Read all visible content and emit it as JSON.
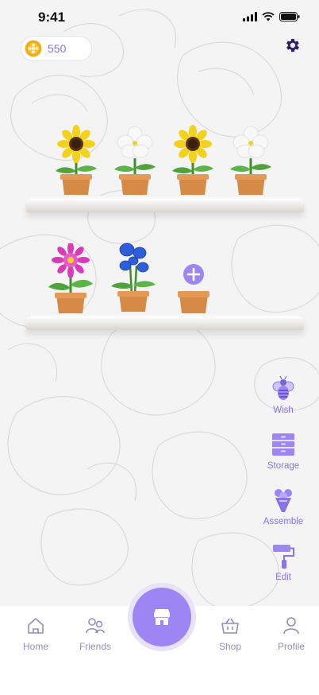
{
  "status_bar": {
    "time": "9:41"
  },
  "coins": {
    "value": "550"
  },
  "shelves": {
    "top": [
      "sunflower",
      "white-flower",
      "sunflower",
      "white-flower"
    ],
    "bottom": [
      "pink-dahlia",
      "blue-flower"
    ]
  },
  "tools": [
    {
      "label": "Wish",
      "icon": "bee-icon"
    },
    {
      "label": "Storage",
      "icon": "drawers-icon"
    },
    {
      "label": "Assemble",
      "icon": "bouquet-icon"
    },
    {
      "label": "Edit",
      "icon": "paint-roller-icon"
    }
  ],
  "nav": {
    "home": "Home",
    "friends": "Friends",
    "shop": "Shop",
    "profile": "Profile"
  },
  "colors": {
    "accent": "#9d86f4",
    "label": "#8a72e8",
    "nav_label": "#8f8fc0"
  }
}
